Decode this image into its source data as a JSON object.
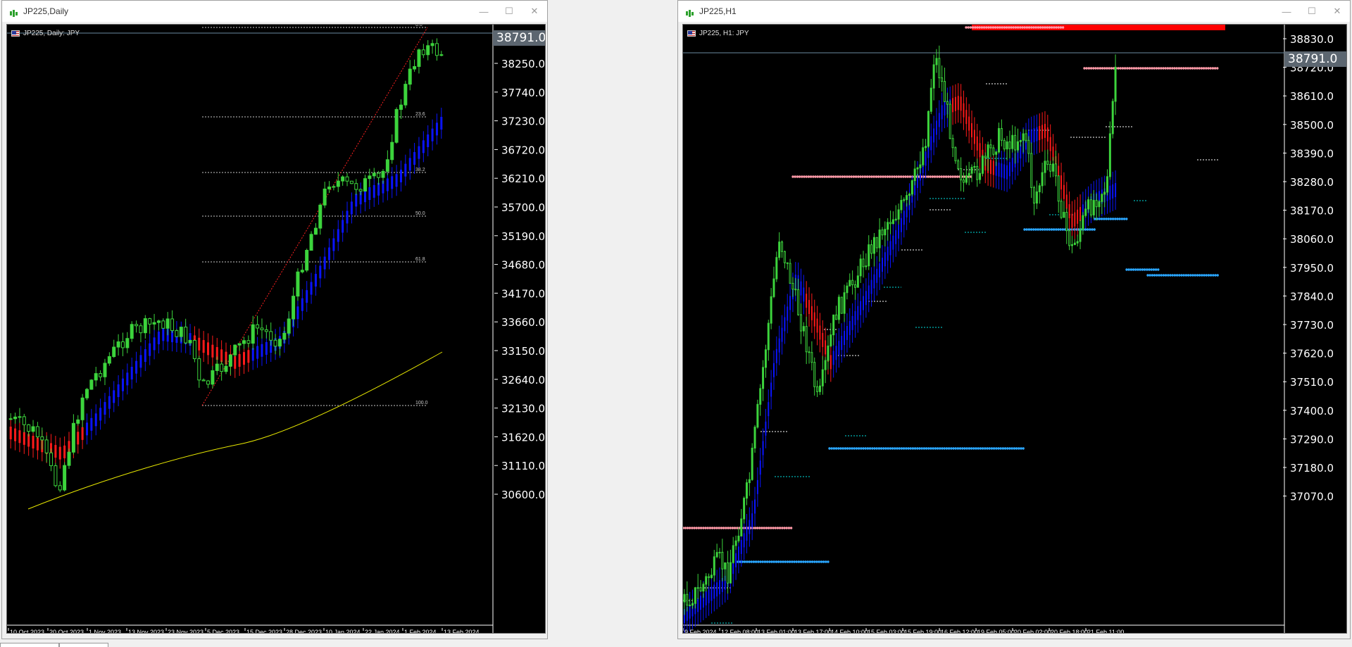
{
  "windows": [
    {
      "title": "JP225,Daily",
      "symbol_label": "JP225, Daily:  JPY",
      "current_price": "38791.0",
      "price_axis": [
        "38250.0",
        "37740.0",
        "37230.0",
        "36720.0",
        "36210.0",
        "35700.0",
        "35190.0",
        "34680.0",
        "34170.0",
        "33660.0",
        "33150.0",
        "32640.0",
        "32130.0",
        "31620.0",
        "31110.0",
        "30600.0"
      ],
      "time_axis": [
        "10 Oct 2023",
        "20 Oct 2023",
        "1 Nov 2023",
        "13 Nov 2023",
        "23 Nov 2023",
        "5 Dec 2023",
        "15 Dec 2023",
        "28 Dec 2023",
        "10 Jan 2024",
        "22 Jan 2024",
        "1 Feb 2024",
        "13 Feb 2024"
      ],
      "fib_levels": [
        "0.0",
        "23.6",
        "38.2",
        "50.0",
        "61.8",
        "100.0"
      ]
    },
    {
      "title": "JP225,H1",
      "symbol_label": "JP225, H1:  JPY",
      "current_price": "38791.0",
      "price_axis": [
        "38830.0",
        "38720.0",
        "38610.0",
        "38500.0",
        "38390.0",
        "38280.0",
        "38170.0",
        "38060.0",
        "37950.0",
        "37840.0",
        "37730.0",
        "37620.0",
        "37510.0",
        "37400.0",
        "37290.0",
        "37180.0",
        "37070.0"
      ],
      "time_axis": [
        "9 Feb 2024",
        "12 Feb 08:00",
        "13 Feb 01:00",
        "13 Feb 17:00",
        "14 Feb 10:00",
        "15 Feb 03:00",
        "15 Feb 19:00",
        "16 Feb 12:00",
        "19 Feb 05:00",
        "20 Feb 02:00",
        "20 Feb 18:00",
        "21 Feb 11:00"
      ]
    }
  ],
  "window_controls": {
    "minimize": "—",
    "maximize": "☐",
    "close": "✕"
  },
  "colors": {
    "bull": "#3cd43c",
    "bear_body": "#000000",
    "trend_up": "#0a14ff",
    "trend_down": "#ff1a1a",
    "ma": "#e6e600",
    "resistance": "#ff9aa8",
    "support": "#2aa6ff"
  },
  "icons": {
    "title": "chart-icon",
    "flag": "us-flag-icon"
  }
}
